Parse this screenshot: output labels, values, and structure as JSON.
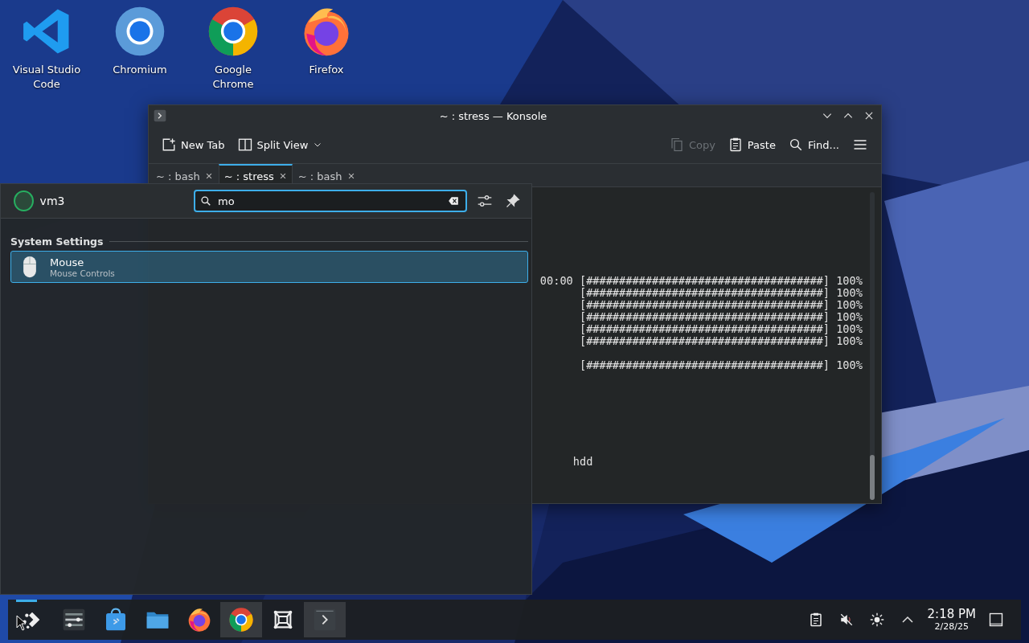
{
  "desktop_icons": [
    {
      "kind": "vscode",
      "label": "Visual Studio Code"
    },
    {
      "kind": "chromium",
      "label": "Chromium"
    },
    {
      "kind": "chrome",
      "label": "Google Chrome"
    },
    {
      "kind": "firefox",
      "label": "Firefox"
    }
  ],
  "konsole": {
    "title": "~ : stress — Konsole",
    "toolbar": [
      {
        "kind": "new-tab",
        "label": "New Tab",
        "disabled": false
      },
      {
        "kind": "split",
        "label": "Split View",
        "disabled": false
      },
      {
        "kind": "copy",
        "label": "Copy",
        "disabled": true
      },
      {
        "kind": "paste",
        "label": "Paste",
        "disabled": false
      },
      {
        "kind": "find",
        "label": "Find...",
        "disabled": false
      }
    ],
    "tabs": [
      {
        "label": "~ : bash",
        "selected": false
      },
      {
        "label": "~ : stress",
        "selected": true
      },
      {
        "label": "~ : bash",
        "selected": false
      }
    ],
    "lines": [
      {
        "kind": "output",
        "text": "00:00",
        "progress": "[####################################] 100%"
      },
      {
        "kind": "output",
        "progress": "[####################################] 100%"
      },
      {
        "kind": "output",
        "progress": "[####################################] 100%"
      },
      {
        "kind": "output",
        "progress": "[####################################] 100%"
      },
      {
        "kind": "output",
        "progress": "[####################################] 100%"
      },
      {
        "kind": "output",
        "progress": "[####################################] 100%"
      },
      {
        "kind": "blank"
      },
      {
        "kind": "output",
        "progress": "[####################################] 100%"
      },
      {
        "kind": "blank"
      },
      {
        "kind": "blank"
      },
      {
        "kind": "blank"
      },
      {
        "kind": "blank"
      },
      {
        "kind": "blank"
      },
      {
        "kind": "blank"
      },
      {
        "kind": "blank"
      },
      {
        "kind": "output",
        "text": "hdd"
      }
    ]
  },
  "launcher": {
    "user": "vm3",
    "search": {
      "value": "mo"
    },
    "sections": [
      {
        "title": "System Settings",
        "results": [
          {
            "title": "Mouse",
            "subtitle": "Mouse Controls",
            "selected": true
          }
        ]
      }
    ]
  },
  "taskbar": {
    "tasks": [
      {
        "kind": "launcher",
        "selected": true,
        "running": false
      },
      {
        "kind": "settings",
        "selected": false,
        "running": false
      },
      {
        "kind": "store",
        "selected": false,
        "running": false
      },
      {
        "kind": "files",
        "selected": false,
        "running": false
      },
      {
        "kind": "firefox",
        "selected": false,
        "running": false
      },
      {
        "kind": "chrome",
        "selected": false,
        "running": true
      },
      {
        "kind": "window",
        "selected": false,
        "running": false
      },
      {
        "kind": "terminal",
        "selected": false,
        "running": true
      }
    ],
    "clock": {
      "time": "2:18 PM",
      "date": "2/28/25"
    }
  }
}
